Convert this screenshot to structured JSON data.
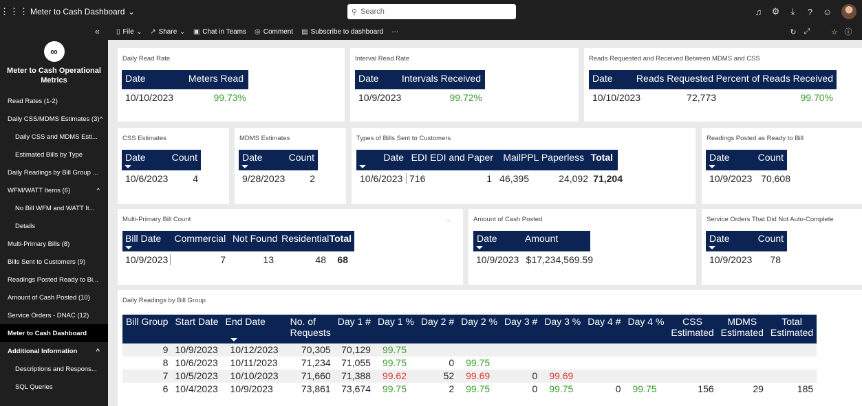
{
  "topbar": {
    "title": "Meter to Cash Dashboard",
    "chevron": "⌄",
    "search_placeholder": "Search"
  },
  "sidebar": {
    "collapse": "«",
    "logo_glyph": "∞",
    "app_title_line1": "Meter to Cash Operational",
    "app_title_line2": "Metrics",
    "items": [
      {
        "label": "Read Rates (1-2)",
        "chev": ""
      },
      {
        "label": "Daily CSS/MDMS Estimates (3)",
        "chev": "^"
      },
      {
        "label": "Daily CSS and MDMS Esti...",
        "chev": ""
      },
      {
        "label": "Estimated Bills by Type",
        "chev": ""
      },
      {
        "label": "Daily Readings by Bill Group ...",
        "chev": ""
      },
      {
        "label": "WFM/WATT Items (6)",
        "chev": "^"
      },
      {
        "label": "No Bill WFM and WATT It...",
        "chev": ""
      },
      {
        "label": "Details",
        "chev": ""
      },
      {
        "label": "Multi-Primary Bills (8)",
        "chev": ""
      },
      {
        "label": "Bills Sent to Customers (9)",
        "chev": ""
      },
      {
        "label": "Readings Posted Ready to Bi...",
        "chev": ""
      },
      {
        "label": "Amount of Cash Posted (10)",
        "chev": ""
      },
      {
        "label": "Service Orders - DNAC (12)",
        "chev": ""
      },
      {
        "label": "Meter to Cash Dashboard",
        "chev": ""
      },
      {
        "label": "Additional Information",
        "chev": "^"
      },
      {
        "label": "Descriptions and Respons...",
        "chev": ""
      },
      {
        "label": "SQL Queries",
        "chev": ""
      }
    ]
  },
  "cmdbar": {
    "file": "File",
    "share": "Share",
    "chat": "Chat in Teams",
    "comment": "Comment",
    "subscribe": "Subscribe to dashboard",
    "more": "···"
  },
  "cards": {
    "daily_read": {
      "title": "Daily Read Rate",
      "h1": "Date",
      "h2": "Meters Read",
      "date": "10/10/2023",
      "value": "99.73%"
    },
    "interval_read": {
      "title": "Interval Read Rate",
      "h1": "Date",
      "h2": "Intervals Received",
      "date": "10/9/2023",
      "value": "99.72%"
    },
    "reads_req": {
      "title": "Reads Requested and Received Between MDMS and CSS",
      "h1": "Date",
      "h2": "Reads Requested",
      "h3": "Percent of Reads Received",
      "date": "10/10/2023",
      "requested": "72,773",
      "percent": "99.70%"
    },
    "css_est": {
      "title": "CSS Estimates",
      "h1": "Date",
      "h2": "Count",
      "date": "10/6/2023",
      "count": "4"
    },
    "mdms_est": {
      "title": "MDMS Estimates",
      "h1": "Date",
      "h2": "Count",
      "date": "9/28/2023",
      "count": "2"
    },
    "bill_types": {
      "title": "Types of Bills Sent to Customers",
      "h1": "Date",
      "h2": "EDI",
      "h3": "EDI and Paper",
      "h4": "Mail",
      "h5": "PPL Paperless",
      "h6": "Total",
      "date": "10/6/2023",
      "edi": "716",
      "edi_paper": "1",
      "mail": "46,395",
      "paperless": "24,092",
      "total": "71,204"
    },
    "ready_bill": {
      "title": "Readings Posted as Ready to Bill",
      "h1": "Date",
      "h2": "Count",
      "date": "10/9/2023",
      "count": "70,608"
    },
    "multi_primary": {
      "title": "Multi-Primary Bill Count",
      "more": "...",
      "h1": "Bill Date",
      "h2": "Commercial",
      "h3": "Not Found",
      "h4": "Residential",
      "h5": "Total",
      "date": "10/9/2023",
      "commercial": "7",
      "not_found": "13",
      "residential": "48",
      "total": "68"
    },
    "cash": {
      "title": "Amount of Cash Posted",
      "h1": "Date",
      "h2": "Amount",
      "date": "10/9/2023",
      "amount": "$17,234,569.59"
    },
    "service": {
      "title": "Service Orders That Did Not Auto-Complete",
      "h1": "Date",
      "h2": "Count",
      "date": "10/9/2023",
      "count": "78"
    },
    "readings": {
      "title": "Daily Readings by Bill Group",
      "headers": [
        "Bill Group",
        "Start Date",
        "End Date",
        "No. of Requests",
        "Day 1 #",
        "Day 1 %",
        "Day 2 #",
        "Day 2 %",
        "Day 3 #",
        "Day 3 %",
        "Day 4 #",
        "Day 4 %",
        "CSS Estimated",
        "MDMS Estimated",
        "Total Estimated"
      ],
      "rows": [
        [
          "9",
          "10/9/2023",
          "10/12/2023",
          "70,305",
          "70,129",
          "99.75",
          "",
          "",
          "",
          "",
          "",
          "",
          "",
          "",
          ""
        ],
        [
          "8",
          "10/6/2023",
          "10/11/2023",
          "71,234",
          "71,055",
          "99.75",
          "0",
          "99.75",
          "",
          "",
          "",
          "",
          "",
          "",
          ""
        ],
        [
          "7",
          "10/5/2023",
          "10/10/2023",
          "71,660",
          "71,388",
          "99.62",
          "52",
          "99.69",
          "0",
          "99.69",
          "",
          "",
          "",
          "",
          ""
        ],
        [
          "6",
          "10/4/2023",
          "10/9/2023",
          "73,861",
          "73,674",
          "99.75",
          "2",
          "99.75",
          "0",
          "99.75",
          "0",
          "99.75",
          "156",
          "29",
          "185"
        ]
      ],
      "pct_colors": [
        [
          "green",
          "",
          "",
          ""
        ],
        [
          "green",
          "green",
          "",
          ""
        ],
        [
          "red",
          "red",
          "red",
          ""
        ],
        [
          "green",
          "green",
          "green",
          "green"
        ]
      ]
    }
  },
  "colors": {
    "header": "#0b2454",
    "green": "#3a9b2c",
    "red": "#e03030",
    "chrome": "#1f1f1f"
  }
}
